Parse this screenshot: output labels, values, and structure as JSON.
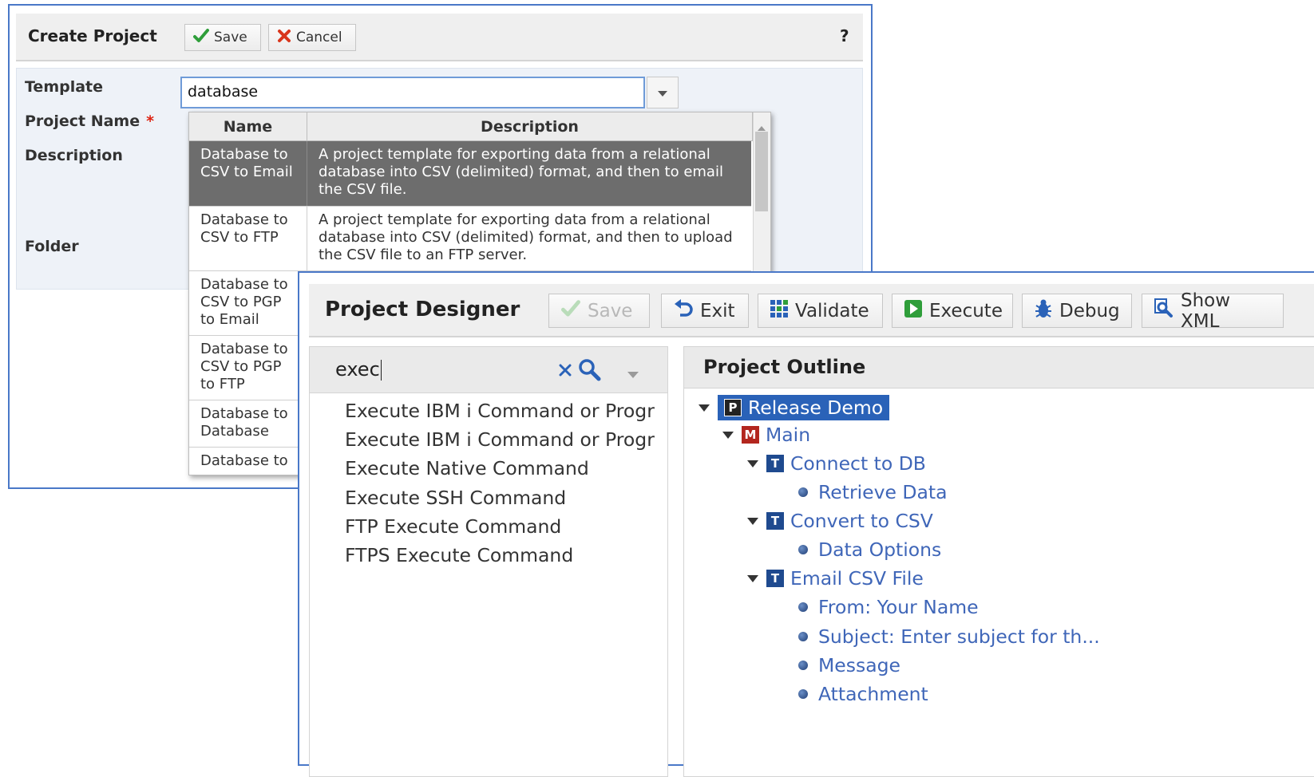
{
  "create_project": {
    "title": "Create Project",
    "save_label": "Save",
    "cancel_label": "Cancel",
    "help_label": "?",
    "labels": {
      "template": "Template",
      "project_name": "Project Name",
      "required_mark": "*",
      "description": "Description",
      "folder": "Folder"
    },
    "template_value": "database",
    "grid": {
      "columns": [
        "Name",
        "Description"
      ],
      "rows": [
        {
          "name": "Database to CSV to Email",
          "description": "A project template for exporting data from a relational database into CSV (delimited) format, and then to email the CSV file.",
          "selected": true
        },
        {
          "name": "Database to CSV to FTP",
          "description": "A project template for exporting data from a relational database into CSV (delimited) format, and then to upload the CSV file to an FTP server.",
          "selected": false
        },
        {
          "name": "Database to CSV to PGP to Email",
          "description": "",
          "selected": false
        },
        {
          "name": "Database to CSV to PGP to FTP",
          "description": "",
          "selected": false
        },
        {
          "name": "Database to Database",
          "description": "",
          "selected": false
        },
        {
          "name": "Database to",
          "description": "",
          "selected": false
        }
      ]
    }
  },
  "project_designer": {
    "title": "Project Designer",
    "toolbar": {
      "save_label": "Save",
      "exit_label": "Exit",
      "validate_label": "Validate",
      "execute_label": "Execute",
      "debug_label": "Debug",
      "show_xml_label": "Show XML"
    },
    "search_value": "exec",
    "palette_items": [
      "Execute IBM i Command or Progr",
      "Execute IBM i Command or Progr",
      "Execute Native Command",
      "Execute SSH Command",
      "FTP Execute Command",
      "FTPS Execute Command"
    ],
    "outline": {
      "title": "Project Outline",
      "project": "Release Demo",
      "main": "Main",
      "tasks": [
        {
          "label": "Connect to DB",
          "children": [
            "Retrieve Data"
          ]
        },
        {
          "label": "Convert to CSV",
          "children": [
            "Data Options"
          ]
        },
        {
          "label": "Email CSV File",
          "children": [
            "From: Your Name",
            "Subject: Enter subject for th...",
            "Message",
            "Attachment"
          ]
        }
      ]
    }
  },
  "colors": {
    "accent_blue": "#2a62b8",
    "link_blue": "#3f66b8",
    "selected_row": "#6d6d6d",
    "save_check": "#2f9e3a",
    "cancel_x": "#d9361c",
    "required": "#dd2211"
  }
}
